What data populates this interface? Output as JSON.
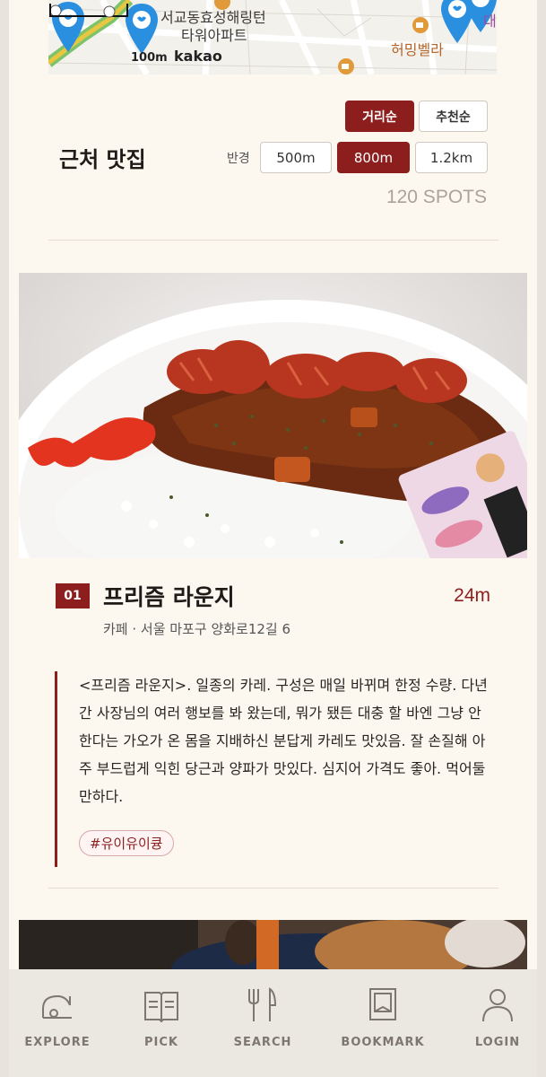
{
  "map": {
    "labels": [
      "서교동효성해링턴",
      "타워아파트",
      "허밍벨라",
      "대"
    ],
    "scale": "100m",
    "brand": "kakao"
  },
  "sort": {
    "distance": "거리순",
    "recommend": "추천순"
  },
  "nearby": {
    "title": "근처 맛집",
    "radius_label": "반경",
    "radius_options": [
      "500m",
      "800m",
      "1.2km"
    ],
    "spots": "120 SPOTS"
  },
  "card": {
    "number": "01",
    "name": "프리즘 라운지",
    "distance": "24m",
    "meta": "카페 · 서울 마포구 양화로12길 6",
    "review": "<프리즘 라운지>. 일종의 카레. 구성은 매일 바뀌며 한정 수량. 다년간 사장님의 여러 행보를 봐 왔는데, 뭐가 됐든 대충 할 바엔 그냥 안 한다는 가오가 온 몸을 지배하신 분답게 카레도 맛있음. 잘 손질해 아주 부드럽게 익힌 당근과 양파가 맛있다. 심지어 가격도 좋아. 먹어둘만하다.",
    "tag": "#유이유이큥"
  },
  "nav": {
    "explore": "EXPLORE",
    "pick": "PICK",
    "search": "SEARCH",
    "bookmark": "BOOKMARK",
    "login": "LOGIN"
  },
  "colors": {
    "accent": "#8c1e1e",
    "background": "#fcf8f0",
    "pin": "#2b8fe0"
  }
}
